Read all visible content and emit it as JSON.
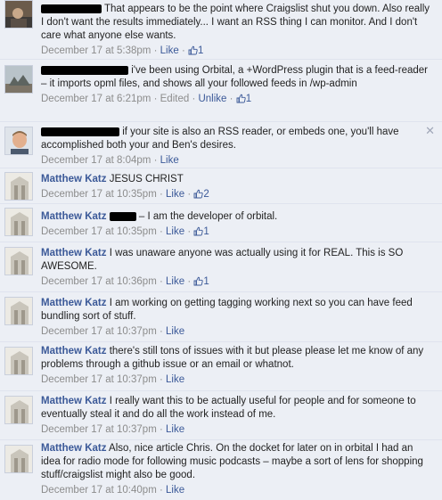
{
  "comments": [
    {
      "author": "",
      "text": "That appears to be the point where Craigslist shut you down. Also really I don't want the results immediately... I want an RSS thing I can monitor. And I don't care what anyone else wants.",
      "time": "December 17 at 5:38pm",
      "like_label": "Like",
      "like_count": "1"
    },
    {
      "author": "",
      "text": "i've been using Orbital, a +WordPress plugin that is a feed-reader – it imports opml files, and shows all your followed feeds in /wp-admin",
      "time": "December 17 at 6:21pm",
      "edited_label": "Edited",
      "unlike_label": "Unlike",
      "like_count": "1"
    },
    {
      "author": "",
      "text": "if your site is also an RSS reader, or embeds one, you'll have accomplished both your and Ben's desires.",
      "time": "December 17 at 8:04pm",
      "like_label": "Like",
      "close_glyph": "✕"
    },
    {
      "author": "Matthew Katz",
      "text": "JESUS CHRIST",
      "time": "December 17 at 10:35pm",
      "like_label": "Like",
      "like_count": "2"
    },
    {
      "author": "Matthew Katz",
      "text": "– I am the developer of orbital.",
      "time": "December 17 at 10:35pm",
      "like_label": "Like",
      "like_count": "1"
    },
    {
      "author": "Matthew Katz",
      "text": "I was unaware anyone was actually using it for REAL. This is SO AWESOME.",
      "time": "December 17 at 10:36pm",
      "like_label": "Like",
      "like_count": "1"
    },
    {
      "author": "Matthew Katz",
      "text": "I am working on getting tagging working next so you can have feed bundling sort of stuff.",
      "time": "December 17 at 10:37pm",
      "like_label": "Like"
    },
    {
      "author": "Matthew Katz",
      "text": "there's still tons of issues with it but please please let me know of any problems through a github issue or an email or whatnot.",
      "time": "December 17 at 10:37pm",
      "like_label": "Like"
    },
    {
      "author": "Matthew Katz",
      "text": "I really want this to be actually useful for people and for someone to eventually steal it and do all the work instead of me.",
      "time": "December 17 at 10:37pm",
      "like_label": "Like"
    },
    {
      "author": "Matthew Katz",
      "text": "Also, nice article Chris. On the docket for later on in orbital I had an idea for radio mode for following music podcasts – maybe a sort of lens for shopping stuff/craigslist might also be good.",
      "time": "December 17 at 10:40pm",
      "like_label": "Like"
    }
  ],
  "colors": {
    "link": "#3b5998",
    "meta": "#8c8c8c",
    "background": "#eceff5"
  },
  "icons": {
    "like": "thumbs-up-icon",
    "close": "close-icon"
  }
}
